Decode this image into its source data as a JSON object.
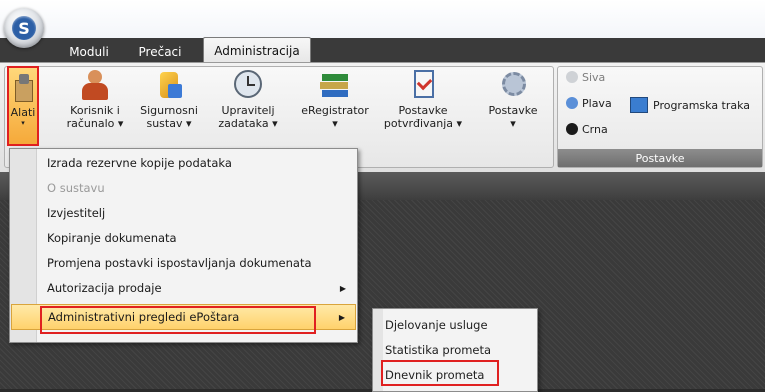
{
  "tabs": [
    "Moduli",
    "Prečaci",
    "Administracija"
  ],
  "ribbon": {
    "alati": "Alati",
    "buttons": [
      {
        "label1": "Korisnik i",
        "label2": "računalo ▾"
      },
      {
        "label1": "Sigurnosni",
        "label2": "sustav ▾"
      },
      {
        "label1": "Upravitelj",
        "label2": "zadataka ▾"
      },
      {
        "label1": "eRegistrator",
        "label2": "▾"
      },
      {
        "label1": "Postavke",
        "label2": "potvrđivanja ▾"
      },
      {
        "label1": "Postavke",
        "label2": "▾"
      }
    ],
    "themes": [
      "Siva",
      "Plava",
      "Crna"
    ],
    "programska_traka": "Programska traka",
    "group_label": "Postavke"
  },
  "menu": {
    "items": [
      {
        "label": "Izrada rezervne kopije podataka"
      },
      {
        "label": "O sustavu"
      },
      {
        "label": "Izvjestitelj"
      },
      {
        "label": "Kopiranje dokumenata"
      },
      {
        "label": "Promjena postavki ispostavljanja dokumenata"
      },
      {
        "label": "Autorizacija prodaje"
      },
      {
        "label": "Administrativni pregledi ePoštara"
      }
    ]
  },
  "submenu": {
    "items": [
      "Djelovanje usluge",
      "Statistika prometa",
      "Dnevnik prometa"
    ]
  },
  "colors": {
    "highlight_outline": "#e02020",
    "menu_hover": "#ffd26c",
    "accent": "#2c5fa6"
  }
}
